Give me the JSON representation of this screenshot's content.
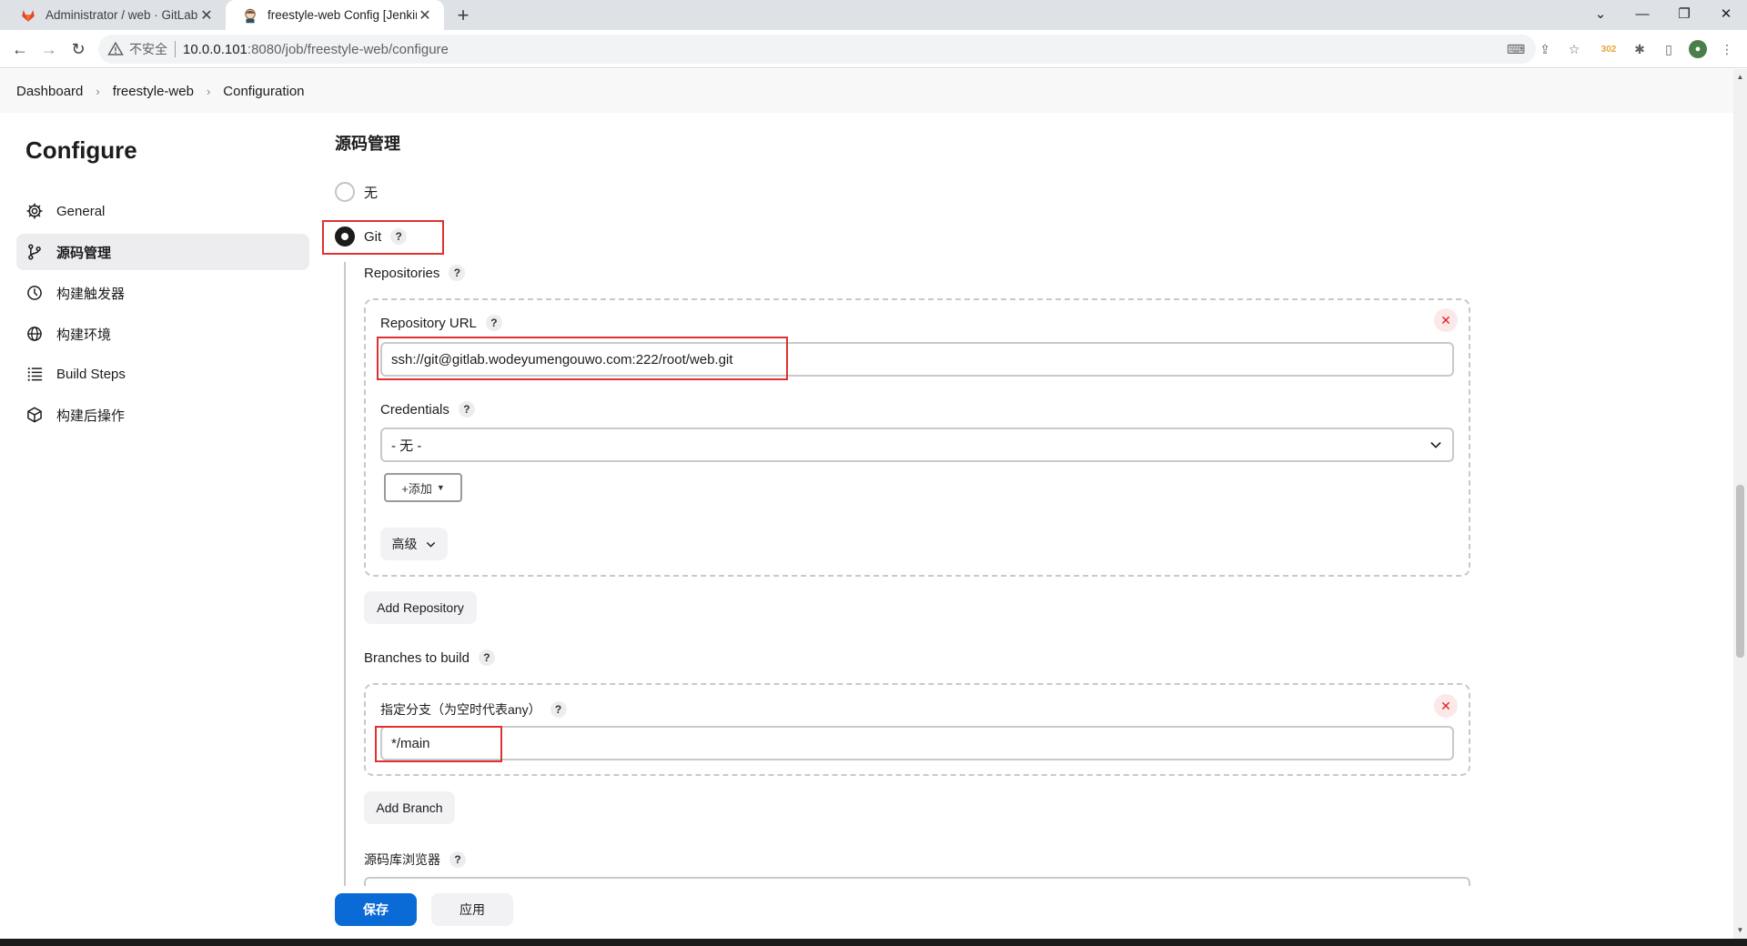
{
  "browser": {
    "tabs": [
      {
        "title": "Administrator / web · GitLab",
        "active": false
      },
      {
        "title": "freestyle-web Config [Jenkins]",
        "active": true
      }
    ],
    "address": {
      "security_label": "不安全",
      "url_host": "10.0.0.101",
      "url_path": ":8080/job/freestyle-web/configure"
    },
    "extension_badge": "302"
  },
  "breadcrumb": [
    "Dashboard",
    "freestyle-web",
    "Configuration"
  ],
  "sidebar": {
    "title": "Configure",
    "items": [
      {
        "label": "General",
        "icon": "gear-icon",
        "active": false
      },
      {
        "label": "源码管理",
        "icon": "branch-icon",
        "active": true
      },
      {
        "label": "构建触发器",
        "icon": "clock-icon",
        "active": false
      },
      {
        "label": "构建环境",
        "icon": "globe-icon",
        "active": false
      },
      {
        "label": "Build Steps",
        "icon": "list-icon",
        "active": false
      },
      {
        "label": "构建后操作",
        "icon": "cube-icon",
        "active": false
      }
    ]
  },
  "scm": {
    "section_title": "源码管理",
    "option_none": "无",
    "option_git": "Git",
    "help_mark": "?",
    "repositories_label": "Repositories",
    "repository_url_label": "Repository URL",
    "repository_url_value": "ssh://git@gitlab.wodeyumengouwo.com:222/root/web.git",
    "credentials_label": "Credentials",
    "credentials_value": "- 无 -",
    "add_button": "+添加",
    "advanced_button": "高级",
    "add_repository_button": "Add Repository",
    "branches_label": "Branches to build",
    "branch_specifier_label": "指定分支（为空时代表any）",
    "branch_value": "*/main",
    "add_branch_button": "Add Branch",
    "repo_browser_label": "源码库浏览器"
  },
  "footer": {
    "save_button": "保存",
    "apply_button": "应用"
  },
  "colors": {
    "primary": "#0b6bd6",
    "highlight": "#e03030"
  }
}
